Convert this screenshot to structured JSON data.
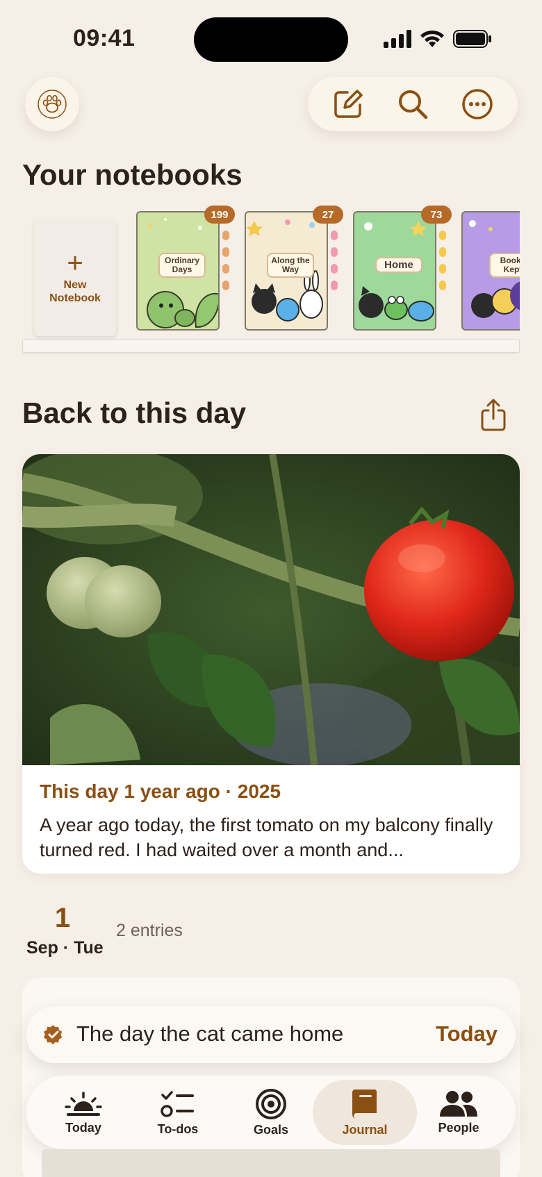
{
  "status_bar": {
    "time": "09:41"
  },
  "header": {
    "profile_icon": "paw-icon",
    "actions": [
      "compose-icon",
      "search-icon",
      "more-icon"
    ]
  },
  "notebooks": {
    "title": "Your notebooks",
    "new_label": "New Notebook",
    "items": [
      {
        "title": "Ordinary Days",
        "count": "199",
        "color": "#cfe3a4"
      },
      {
        "title": "Along the Way",
        "count": "27",
        "color": "#f5ead2"
      },
      {
        "title": "Home",
        "count": "73",
        "color": "#9ed89a"
      },
      {
        "title": "Books Kept",
        "count": "",
        "color": "#b89be6"
      }
    ]
  },
  "back_to_day": {
    "title": "Back to this day",
    "memory_heading": "This day 1 year ago · 2025",
    "memory_text": "A year ago today, the first tomato on my balcony finally turned red. I had waited over a month and..."
  },
  "date_group": {
    "day": "1",
    "sub": "Sep · Tue",
    "entries": "2 entries"
  },
  "banner": {
    "title": "The day the cat came home",
    "action": "Today"
  },
  "tabs": [
    {
      "label": "Today",
      "icon": "sunrise-icon"
    },
    {
      "label": "To-dos",
      "icon": "checklist-icon"
    },
    {
      "label": "Goals",
      "icon": "target-icon"
    },
    {
      "label": "Journal",
      "icon": "book-icon",
      "active": true
    },
    {
      "label": "People",
      "icon": "people-icon"
    }
  ],
  "colors": {
    "accent": "#8a4f12",
    "badge": "#b56a28",
    "background": "#f5efe8"
  }
}
